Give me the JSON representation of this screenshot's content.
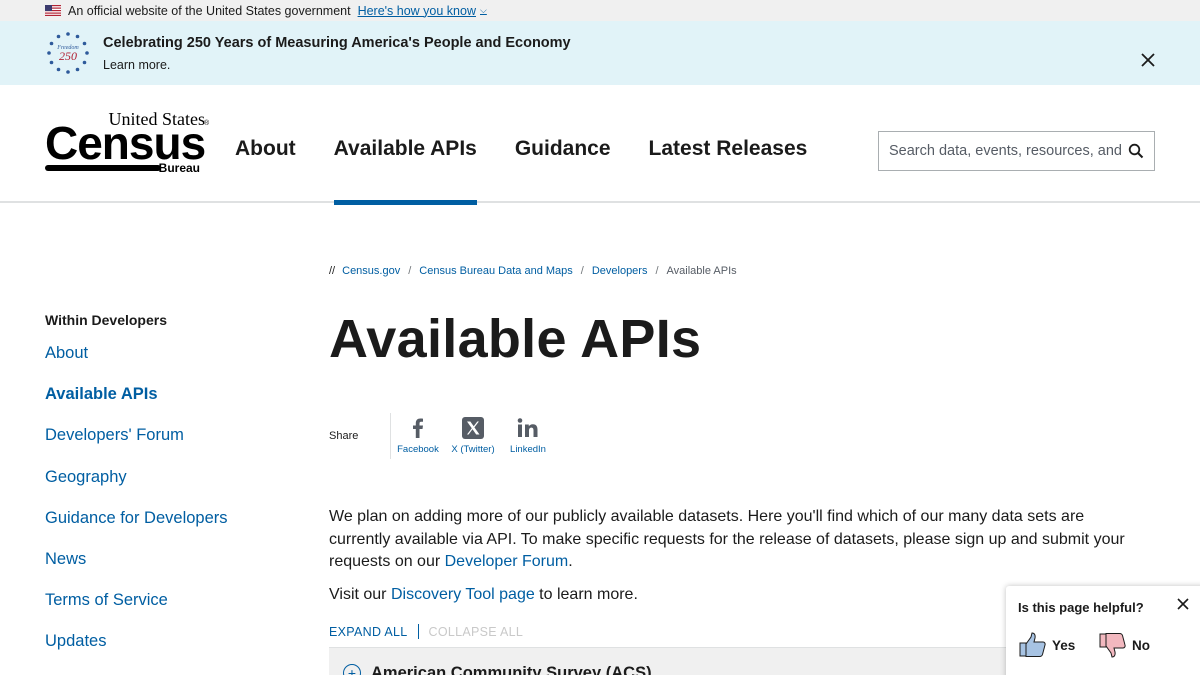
{
  "gov_banner": {
    "text": "An official website of the United States government",
    "link": "Here's how you know"
  },
  "announcement": {
    "badge_line1": "Freedom",
    "badge_line2": "250",
    "title": "Celebrating 250 Years of Measuring America's People and Economy",
    "more": "Learn more."
  },
  "logo": {
    "top": "United States",
    "main": "Census",
    "bottom": "Bureau"
  },
  "nav": {
    "items": [
      {
        "label": "About"
      },
      {
        "label": "Available APIs"
      },
      {
        "label": "Guidance"
      },
      {
        "label": "Latest Releases"
      }
    ],
    "active_index": 1
  },
  "search": {
    "placeholder": "Search data, events, resources, and more"
  },
  "breadcrumb": {
    "prefix": "//",
    "items": [
      "Census.gov",
      "Census Bureau Data and Maps",
      "Developers"
    ],
    "current": "Available APIs"
  },
  "sidebar": {
    "heading": "Within Developers",
    "items": [
      {
        "label": "About"
      },
      {
        "label": "Available APIs"
      },
      {
        "label": "Developers' Forum"
      },
      {
        "label": "Geography"
      },
      {
        "label": "Guidance for Developers"
      },
      {
        "label": "News"
      },
      {
        "label": "Terms of Service"
      },
      {
        "label": "Updates"
      }
    ]
  },
  "page": {
    "title": "Available APIs",
    "share_label": "Share",
    "share": [
      {
        "label": "Facebook",
        "icon": "facebook-icon"
      },
      {
        "label": "X (Twitter)",
        "icon": "x-twitter-icon"
      },
      {
        "label": "LinkedIn",
        "icon": "linkedin-icon"
      }
    ],
    "paragraph1_before": "We plan on adding more of our publicly available datasets. Here you'll find which of our many data sets are currently available via API. To make specific requests for the release of datasets, please sign up and submit your requests on our ",
    "paragraph1_link": "Developer Forum",
    "paragraph1_after": ".",
    "paragraph2_before": "Visit our ",
    "paragraph2_link": "Discovery Tool page",
    "paragraph2_after": " to learn more.",
    "expand_all": "EXPAND ALL",
    "collapse_all": "COLLAPSE ALL",
    "accordion_first": "American Community Survey (ACS)"
  },
  "feedback": {
    "title": "Is this page helpful?",
    "yes": "Yes",
    "no": "No"
  },
  "colors": {
    "link": "#005ea2",
    "announcement_bg": "#e1f3f8",
    "banner_bg": "#f0f0f0"
  }
}
